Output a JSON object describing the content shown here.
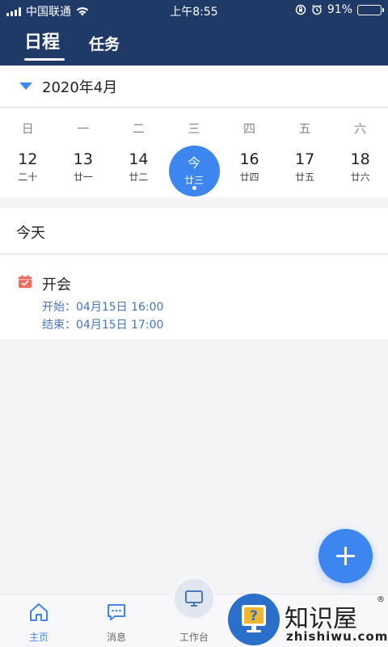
{
  "status_bar": {
    "carrier": "中国联通",
    "time": "上午8:55",
    "battery": "91%",
    "battery_level": 0.91
  },
  "tabs": [
    {
      "label": "日程",
      "active": true
    },
    {
      "label": "任务",
      "active": false
    }
  ],
  "month": {
    "label": "2020年4月"
  },
  "weekdays": [
    "日",
    "一",
    "二",
    "三",
    "四",
    "五",
    "六"
  ],
  "days": [
    {
      "num": "12",
      "lunar": "二十"
    },
    {
      "num": "13",
      "lunar": "廿一"
    },
    {
      "num": "14",
      "lunar": "廿二"
    },
    {
      "num": "今",
      "lunar": "廿三",
      "selected": true
    },
    {
      "num": "16",
      "lunar": "廿四"
    },
    {
      "num": "17",
      "lunar": "廿五"
    },
    {
      "num": "18",
      "lunar": "廿六"
    }
  ],
  "today": {
    "title": "今天"
  },
  "event": {
    "title": "开会",
    "start": "开始：04月15日 16:00",
    "end": "结束：04月15日 17:00"
  },
  "bottom_nav": [
    {
      "label": "主页",
      "icon": "home-icon"
    },
    {
      "label": "消息",
      "icon": "message-icon"
    },
    {
      "label": "工作台",
      "icon": "monitor-icon"
    },
    {
      "label": "",
      "icon": ""
    },
    {
      "label": "",
      "icon": ""
    }
  ],
  "watermark": {
    "text": "知识屋",
    "domain": "zhishiwu.com",
    "reg": "®"
  },
  "colors": {
    "header": "#1f3a66",
    "accent": "#3d86f0",
    "event_icon": "#f26b5b",
    "event_time": "#4a76b5"
  }
}
